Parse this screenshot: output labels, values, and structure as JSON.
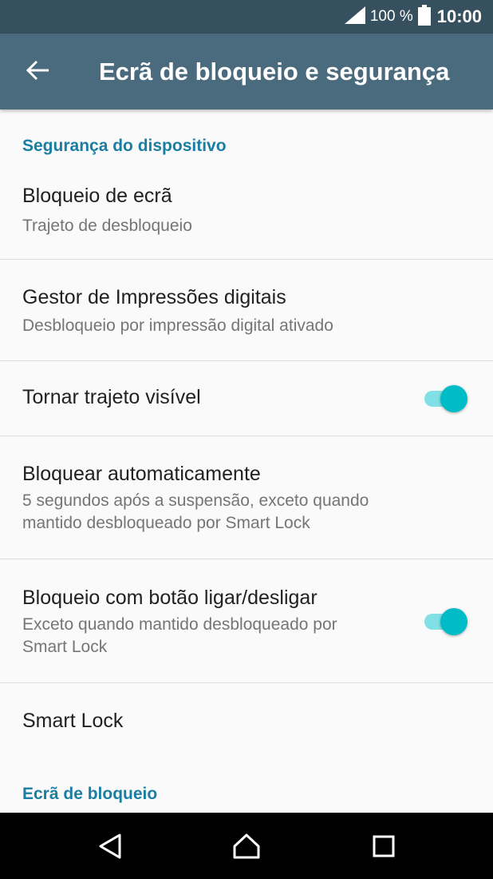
{
  "status_bar": {
    "battery_percent": "100 %",
    "time": "10:00",
    "icons": [
      "signal-icon",
      "battery-icon"
    ]
  },
  "app_bar": {
    "title": "Ecrã de bloqueio e segurança",
    "back_icon": "back-arrow-icon"
  },
  "sections": {
    "device_security": "Segurança do dispositivo",
    "lock_screen": "Ecrã de bloqueio"
  },
  "settings": [
    {
      "title": "Bloqueio de ecrã",
      "summary": "Trajeto de desbloqueio"
    },
    {
      "title": "Gestor de Impressões digitais",
      "summary": "Desbloqueio por impressão digital ativado"
    },
    {
      "title": "Tornar trajeto visível",
      "toggle": true
    },
    {
      "title": "Bloquear automaticamente",
      "summary_lines": [
        "5 segundos após a suspensão, exceto quando",
        "mantido desbloqueado por Smart Lock"
      ]
    },
    {
      "title": "Bloqueio com botão ligar/desligar",
      "summary_lines": [
        "Exceto quando mantido desbloqueado por",
        "Smart Lock"
      ],
      "toggle": true
    },
    {
      "title": "Smart Lock"
    }
  ],
  "colors": {
    "status_bar": "#36505f",
    "app_bar": "#4a6a7d",
    "accent": "#1a7ea3",
    "toggle_on": "#00bcc6"
  },
  "nav_bar": {
    "icons": [
      "back-triangle-icon",
      "home-icon",
      "recents-icon"
    ]
  }
}
